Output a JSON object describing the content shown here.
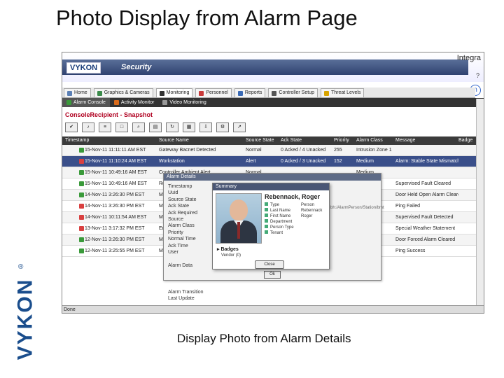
{
  "slide": {
    "title": "Photo Display from Alarm Page",
    "caption": "Display Photo from Alarm Details",
    "side_logo": "VYKON",
    "side_logo_reg": "®"
  },
  "app": {
    "logo": "VYKON",
    "product": "Security",
    "right_brand": "Integra",
    "help": "?",
    "nav_tabs": [
      "Home",
      "Graphics & Cameras",
      "Monitoring",
      "Personnel",
      "Reports",
      "Controller Setup",
      "Threat Levels"
    ],
    "sub_tabs": [
      "Alarm Console",
      "Activity Monitor",
      "Video Monitoring"
    ],
    "panel_title": "ConsoleRecipient - Snapshot",
    "status_left": "Done",
    "zoom": "Done"
  },
  "table": {
    "columns": [
      "Timestamp",
      "Source Name",
      "Source State",
      "Ack State",
      "Priority",
      "Alarm Class",
      "Message",
      "Badge"
    ],
    "rows": [
      {
        "time": "15-Nov-11 11:11:11 AM EST",
        "source": "Gateway Bacnet Detected",
        "state": "Normal",
        "ack": "0 Acked / 4 Unacked",
        "pri": "255",
        "cls": "Intrusion Zone 1",
        "msg": "",
        "color": "#3a9a3a",
        "sel": false
      },
      {
        "time": "15-Nov-11 11:10:24 AM EST",
        "source": "Workstation",
        "state": "Alert",
        "ack": "0 Acked / 3 Unacked",
        "pri": "152",
        "cls": "Medium",
        "msg": "Alarm: Stable State Mismatch",
        "color": "#d94040",
        "sel": true
      },
      {
        "time": "15-Nov-11 10:49:16 AM EST",
        "source": "Controller Ambient Alert",
        "state": "Normal",
        "ack": "",
        "pri": "",
        "cls": "Medium",
        "msg": "",
        "color": "#3a9a3a",
        "sel": false
      },
      {
        "time": "15-Nov-11 10:49:16 AM EST",
        "source": "Reader",
        "state": "",
        "ack": "",
        "pri": "",
        "cls": "",
        "msg": "Supervised Fault Cleared",
        "color": "#3a9a3a",
        "sel": false
      },
      {
        "time": "14-Nov-11 3:26:30 PM EST",
        "source": "MENU_",
        "state": "",
        "ack": "",
        "pri": "",
        "cls": "",
        "msg": "Door Held Open Alarm Cleared",
        "color": "#3a9a3a",
        "sel": false
      },
      {
        "time": "14-Nov-11 3:26:30 PM EST",
        "source": "Magic",
        "state": "",
        "ack": "",
        "pri": "",
        "cls": "",
        "msg": "Ping Failed",
        "color": "#d94040",
        "sel": false
      },
      {
        "time": "14-Nov-11 10:11:54 AM EST",
        "source": "MENU",
        "state": "",
        "ack": "",
        "pri": "",
        "cls": "",
        "msg": "Supervised Fault Detected",
        "color": "#d94040",
        "sel": false
      },
      {
        "time": "13-Nov-11 3:17:32 PM EST",
        "source": "Enclave",
        "state": "",
        "ack": "",
        "pri": "",
        "cls": "",
        "msg": "Special Weather Statement",
        "color": "#d94040",
        "sel": false
      },
      {
        "time": "12-Nov-11 3:26:30 PM EST",
        "source": "MENU_",
        "state": "",
        "ack": "",
        "pri": "",
        "cls": "",
        "msg": "Door Forced Alarm Cleared",
        "color": "#3a9a3a",
        "sel": false
      },
      {
        "time": "12-Nov-11 3:25:55 PM EST",
        "source": "Magic",
        "state": "",
        "ack": "",
        "pri": "",
        "cls": "",
        "msg": "Ping Success",
        "color": "#3a9a3a",
        "sel": false
      }
    ]
  },
  "alarm_details": {
    "title": "Alarm Details",
    "fields": [
      "Timestamp",
      "Uuid",
      "Source State",
      "Ack State",
      "Ack Required",
      "Source",
      "Alarm Class",
      "Priority",
      "Normal Time",
      "Ack Time",
      "User",
      "",
      "Alarm Data",
      "",
      "",
      "",
      "Alarm Transition",
      "Last Update"
    ],
    "side_text": "bh:/AlarmPerson/Station/bmt",
    "ok": "Ok"
  },
  "summary": {
    "title": "Summary",
    "name": "Rebennack, Roger",
    "props": [
      {
        "k": "Type",
        "v": "Person"
      },
      {
        "k": "Last Name",
        "v": "Rebennack"
      },
      {
        "k": "First Name",
        "v": "Roger"
      },
      {
        "k": "Department",
        "v": ""
      },
      {
        "k": "Person Type",
        "v": ""
      },
      {
        "k": "Tenant",
        "v": ""
      }
    ],
    "badges_label": "Badges",
    "badge_item": "Vendor (0)",
    "close": "Close"
  }
}
